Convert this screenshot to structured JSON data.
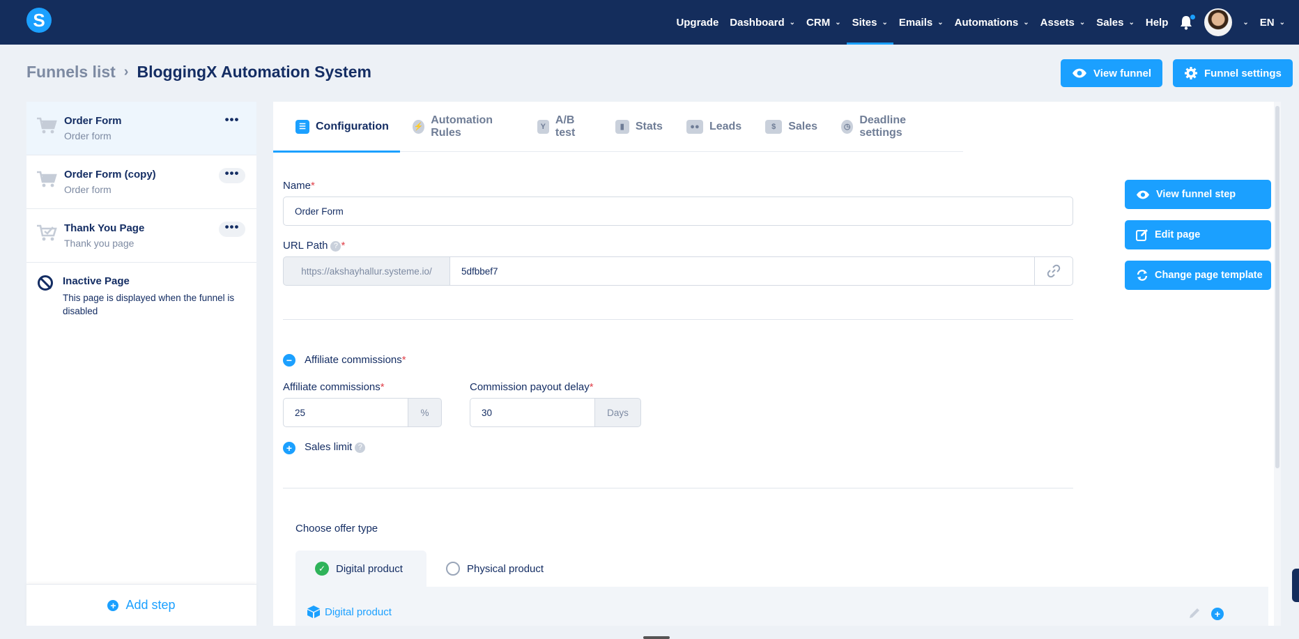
{
  "nav": {
    "logo": "S",
    "items": [
      {
        "label": "Upgrade",
        "has_menu": false
      },
      {
        "label": "Dashboard",
        "has_menu": true
      },
      {
        "label": "CRM",
        "has_menu": true
      },
      {
        "label": "Sites",
        "has_menu": true
      },
      {
        "label": "Emails",
        "has_menu": true
      },
      {
        "label": "Automations",
        "has_menu": true
      },
      {
        "label": "Assets",
        "has_menu": true
      },
      {
        "label": "Sales",
        "has_menu": true
      },
      {
        "label": "Help",
        "has_menu": false
      }
    ],
    "active_item": "Sites",
    "language": "EN"
  },
  "header": {
    "breadcrumb_root": "Funnels list",
    "title": "BloggingX Automation System",
    "view_funnel": "View funnel",
    "funnel_settings": "Funnel settings"
  },
  "steps": [
    {
      "title": "Order Form",
      "subtitle": "Order form",
      "active": true
    },
    {
      "title": "Order Form (copy)",
      "subtitle": "Order form",
      "active": false
    },
    {
      "title": "Thank You Page",
      "subtitle": "Thank you page",
      "active": false
    }
  ],
  "inactive_page": {
    "title": "Inactive Page",
    "description": "This page is displayed when the funnel is disabled"
  },
  "add_step": "Add step",
  "tabs": [
    {
      "label": "Configuration",
      "icon": "sliders-icon",
      "active": true
    },
    {
      "label": "Automation Rules",
      "icon": "bolt-icon",
      "active": false
    },
    {
      "label": "A/B test",
      "icon": "split-icon",
      "active": false
    },
    {
      "label": "Stats",
      "icon": "bar-chart-icon",
      "active": false
    },
    {
      "label": "Leads",
      "icon": "users-icon",
      "active": false
    },
    {
      "label": "Sales",
      "icon": "dollar-icon",
      "active": false
    },
    {
      "label": "Deadline settings",
      "icon": "clock-icon",
      "active": false
    }
  ],
  "form": {
    "name_label": "Name",
    "name_value": "Order Form",
    "url_label": "URL Path",
    "url_prefix": "https://akshayhallur.systeme.io/",
    "url_value": "5dfbbef7",
    "affiliate_section": "Affiliate commissions",
    "affiliate_label": "Affiliate commissions",
    "affiliate_value": "25",
    "affiliate_unit": "%",
    "payout_label": "Commission payout delay",
    "payout_value": "30",
    "payout_unit": "Days",
    "sales_limit": "Sales limit",
    "offer_type_label": "Choose offer type",
    "offer_types": [
      "Digital product",
      "Physical product"
    ],
    "selected_offer": "Digital product",
    "product_link": "Digital product"
  },
  "side_actions": {
    "view_step": "View funnel step",
    "edit_page": "Edit page",
    "change_template": "Change page template"
  },
  "colors": {
    "nav_bg": "#142d5c",
    "accent": "#1ba0ff",
    "text": "#142d63",
    "muted": "#7d8aa2",
    "success": "#2fb35a",
    "required": "#e0414a"
  }
}
